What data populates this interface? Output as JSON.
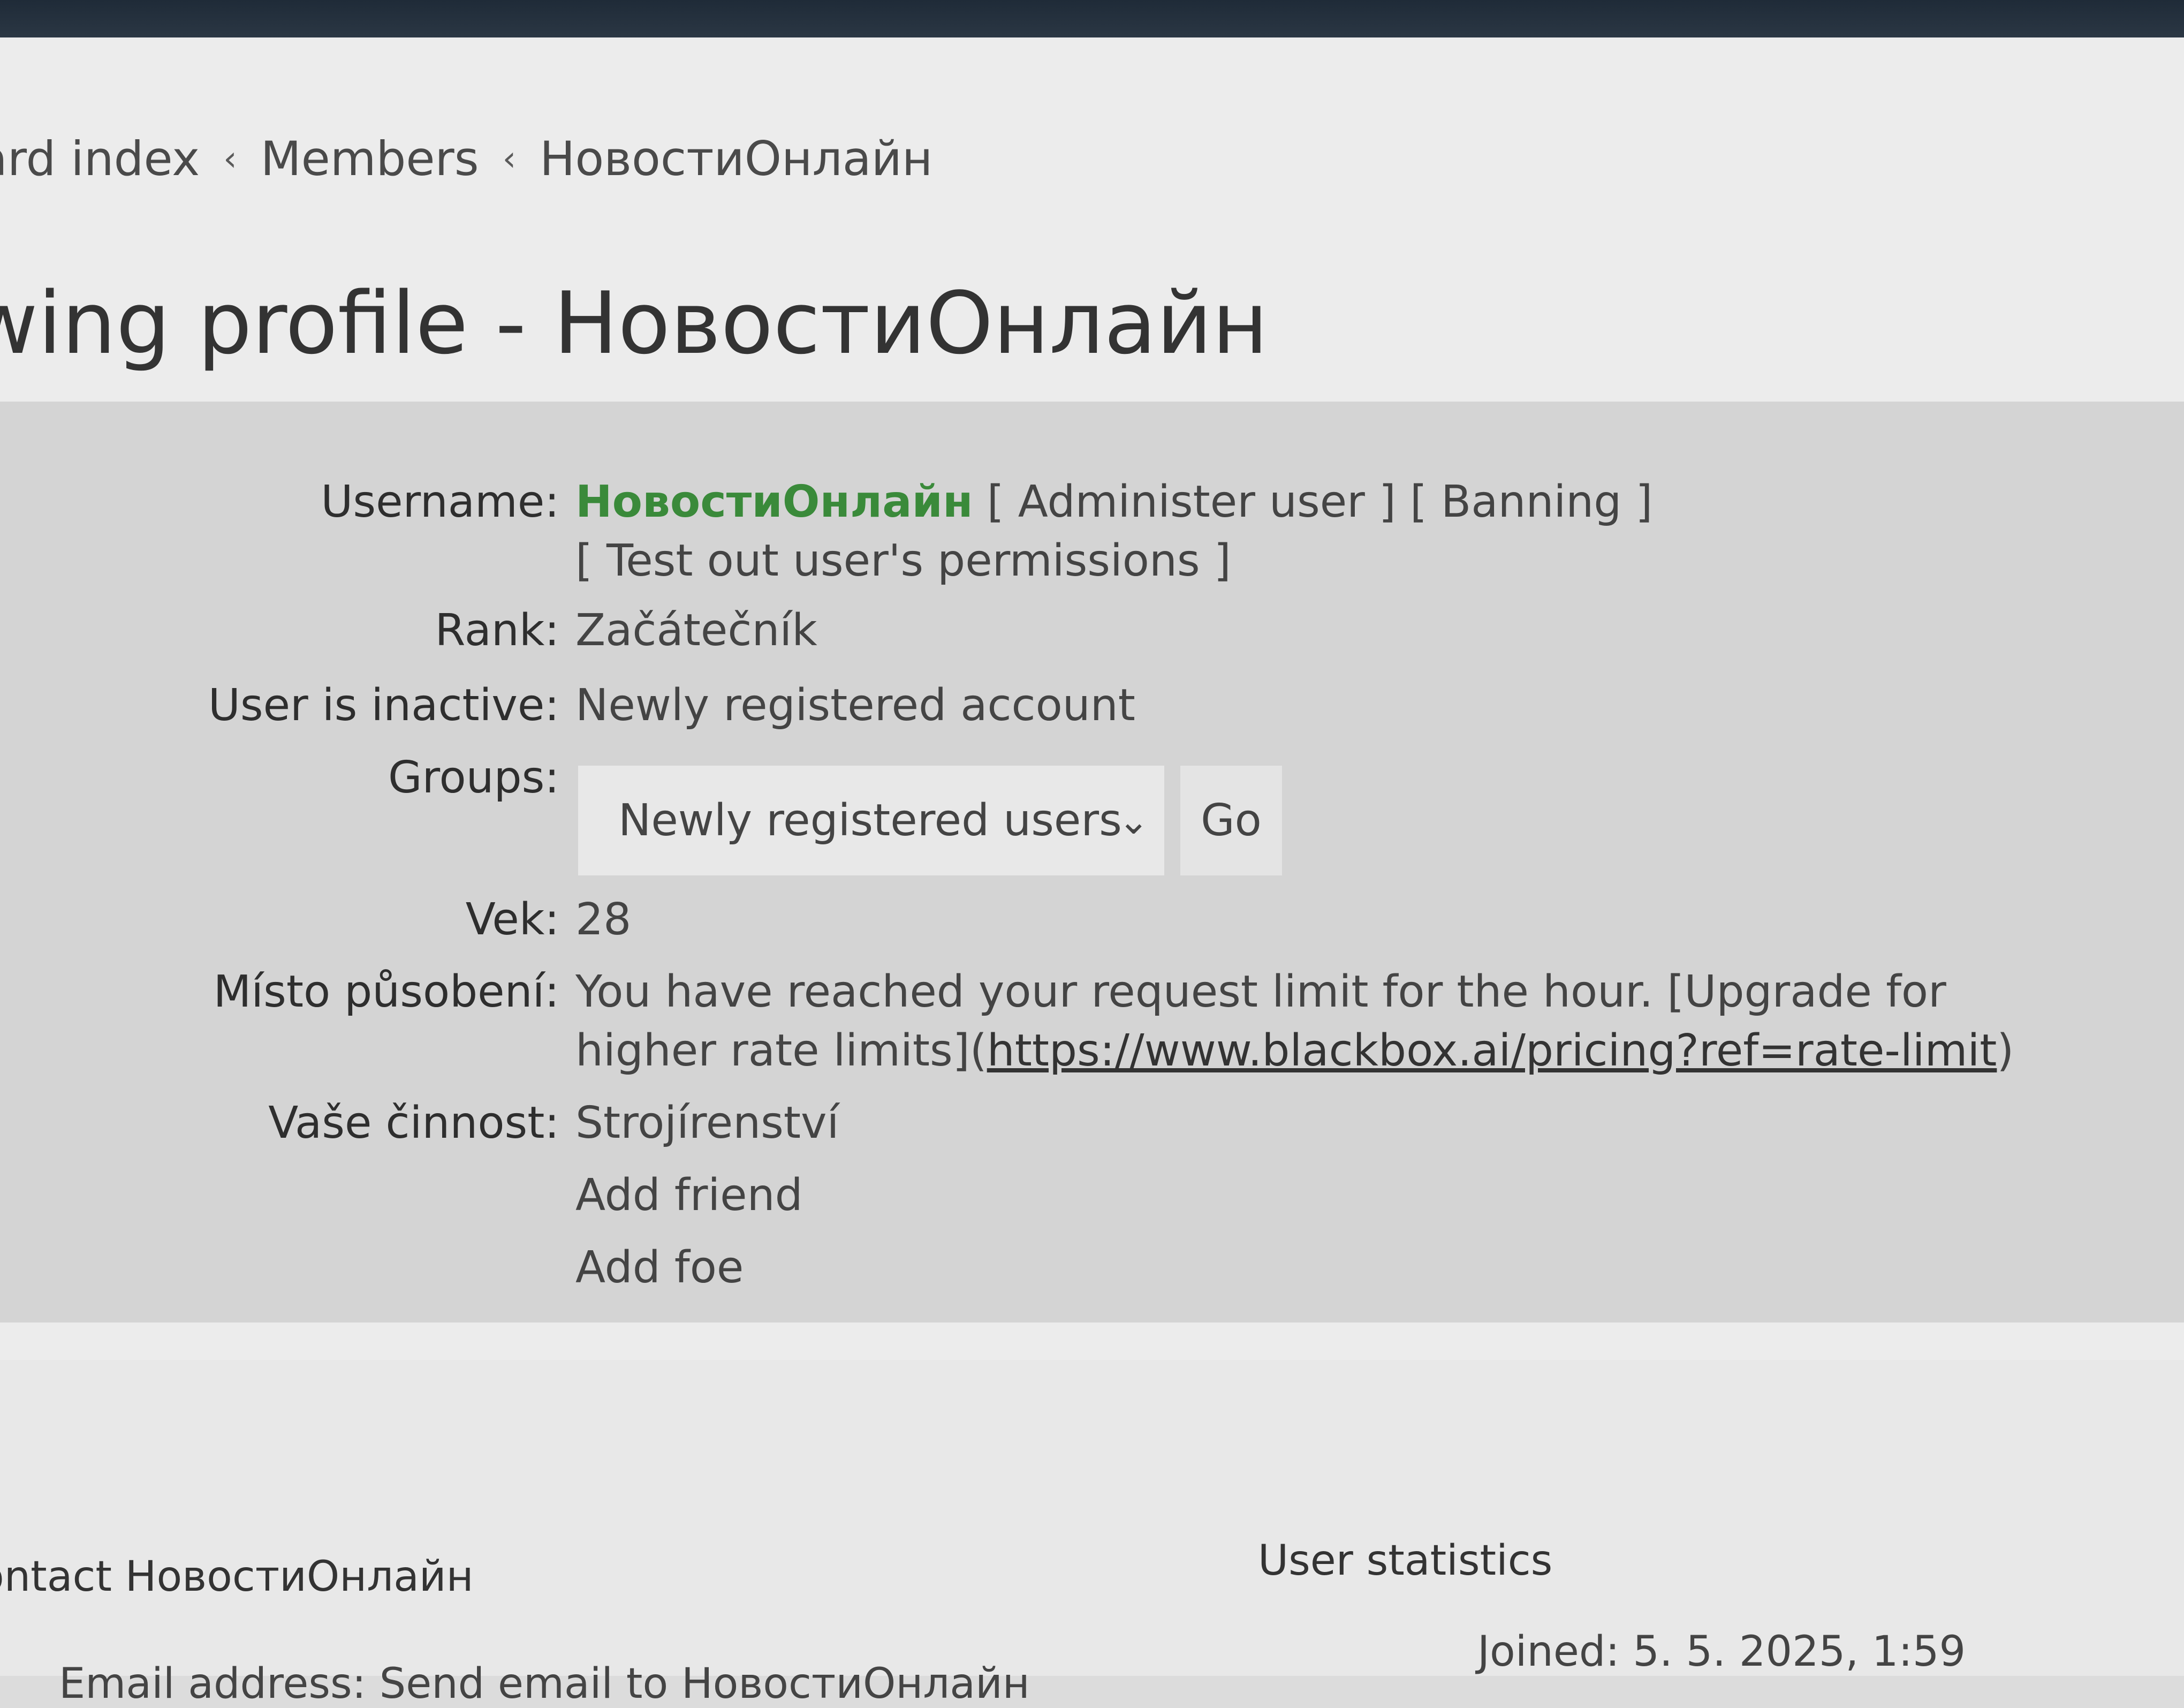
{
  "breadcrumb": {
    "items": [
      "ard index",
      "Members",
      "НовостиОнлайн"
    ],
    "separator": "‹"
  },
  "page_title": "wing profile - НовостиОнлайн",
  "profile": {
    "username": {
      "label": "Username:",
      "name": "НовостиОнлайн",
      "administer_link": "[ Administer user ]",
      "banning_link": "[ Banning ]",
      "permissions_link": "[ Test out user's permissions ]"
    },
    "rank": {
      "label": "Rank:",
      "value": "Začátečník"
    },
    "inactive": {
      "label": "User is inactive:",
      "value": "Newly registered account"
    },
    "groups": {
      "label": "Groups:",
      "selected": "Newly registered users",
      "go_label": "Go"
    },
    "vek": {
      "label": "Vek:",
      "value": "28"
    },
    "misto": {
      "label": "Místo působení:",
      "text_line1": "You have reached your request limit for the hour. [Upgrade for",
      "text_line2_prefix": "higher rate limits](",
      "url": "https://www.blackbox.ai/pricing?ref=rate-limit",
      "text_line2_suffix": ")"
    },
    "cinnost": {
      "label": "Vaše činnost:",
      "value": "Strojírenství"
    },
    "add_friend": "Add friend",
    "add_foe": "Add foe"
  },
  "contact": {
    "heading": "ontact НовостиОнлайн",
    "email_line": "Email address: Send email to НовостиОнлайн"
  },
  "stats": {
    "heading": "User statistics",
    "joined": "Joined: 5. 5. 2025, 1:59"
  },
  "colors": {
    "username": "#3a8a3a",
    "panel": "#d4d4d4",
    "page": "#ececec"
  },
  "icons": {
    "dropdown": "chevron-down-icon"
  }
}
